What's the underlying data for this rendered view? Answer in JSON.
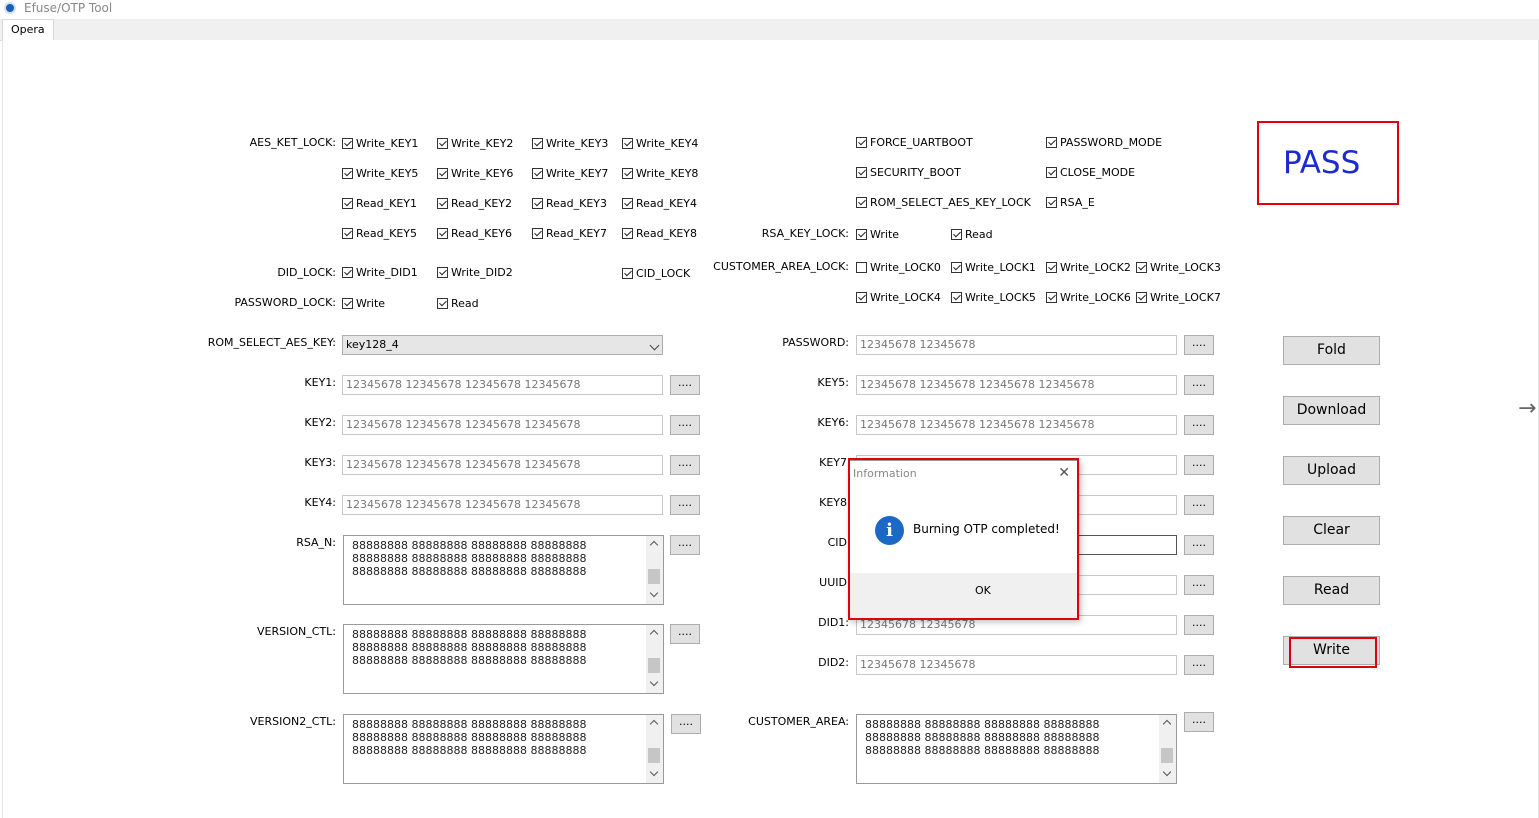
{
  "window": {
    "title": "Efuse/OTP Tool",
    "tab": "Opera"
  },
  "checks": {
    "aes_ket_lock_label": "AES_KET_LOCK:",
    "write_key1": "Write_KEY1",
    "write_key2": "Write_KEY2",
    "write_key3": "Write_KEY3",
    "write_key4": "Write_KEY4",
    "write_key5": "Write_KEY5",
    "write_key6": "Write_KEY6",
    "write_key7": "Write_KEY7",
    "write_key8": "Write_KEY8",
    "read_key1": "Read_KEY1",
    "read_key2": "Read_KEY2",
    "read_key3": "Read_KEY3",
    "read_key4": "Read_KEY4",
    "read_key5": "Read_KEY5",
    "read_key6": "Read_KEY6",
    "read_key7": "Read_KEY7",
    "read_key8": "Read_KEY8",
    "did_lock_label": "DID_LOCK:",
    "write_did1": "Write_DID1",
    "write_did2": "Write_DID2",
    "cid_lock": "CID_LOCK",
    "password_lock_label": "PASSWORD_LOCK:",
    "pw_write": "Write",
    "pw_read": "Read",
    "force_uartboot": "FORCE_UARTBOOT",
    "password_mode": "PASSWORD_MODE",
    "security_boot": "SECURITY_BOOT",
    "close_mode": "CLOSE_MODE",
    "rom_select_aes_key_lock": "ROM_SELECT_AES_KEY_LOCK",
    "rsa_e": "RSA_E",
    "rsa_key_lock_label": "RSA_KEY_LOCK:",
    "rsa_write": "Write",
    "rsa_read": "Read",
    "customer_area_lock_label": "CUSTOMER_AREA_LOCK:",
    "write_lock0": "Write_LOCK0",
    "write_lock1": "Write_LOCK1",
    "write_lock2": "Write_LOCK2",
    "write_lock3": "Write_LOCK3",
    "write_lock4": "Write_LOCK4",
    "write_lock5": "Write_LOCK5",
    "write_lock6": "Write_LOCK6",
    "write_lock7": "Write_LOCK7"
  },
  "fields": {
    "rom_select_label": "ROM_SELECT_AES_KEY:",
    "rom_select_value": "key128_4",
    "key1_label": "KEY1:",
    "key1": "12345678 12345678 12345678 12345678",
    "key2_label": "KEY2:",
    "key2": "12345678 12345678 12345678 12345678",
    "key3_label": "KEY3:",
    "key3": "12345678 12345678 12345678 12345678",
    "key4_label": "KEY4:",
    "key4": "12345678 12345678 12345678 12345678",
    "rsa_n_label": "RSA_N:",
    "rsa_n": "88888888 88888888 88888888 88888888\n88888888 88888888 88888888 88888888\n88888888 88888888 88888888 88888888",
    "version_ctl_label": "VERSION_CTL:",
    "version_ctl": "88888888 88888888 88888888 88888888\n88888888 88888888 88888888 88888888\n88888888 88888888 88888888 88888888",
    "version2_ctl_label": "VERSION2_CTL:",
    "version2_ctl": "88888888 88888888 88888888 88888888\n88888888 88888888 88888888 88888888\n88888888 88888888 88888888 88888888",
    "password_label": "PASSWORD:",
    "password": "12345678 12345678",
    "key5_label": "KEY5:",
    "key5": "12345678 12345678 12345678 12345678",
    "key6_label": "KEY6:",
    "key6": "12345678 12345678 12345678 12345678",
    "key7_label": "KEY7",
    "key8_label": "KEY8",
    "cid_label": "CID",
    "uuid_label": "UUID",
    "did1_label": "DID1:",
    "did1": "12345678 12345678",
    "did2_label": "DID2:",
    "did2": "12345678 12345678",
    "customer_area_label": "CUSTOMER_AREA:",
    "customer_area": "88888888 88888888 88888888 88888888\n88888888 88888888 88888888 88888888\n88888888 88888888 88888888 88888888",
    "dots": "...."
  },
  "status": {
    "result": "PASS"
  },
  "buttons": {
    "fold": "Fold",
    "download": "Download",
    "upload": "Upload",
    "clear": "Clear",
    "read": "Read",
    "write": "Write"
  },
  "dialog": {
    "title": "Information",
    "close": "✕",
    "icon": "i",
    "message": "Burning OTP completed!",
    "ok": "OK"
  },
  "colors": {
    "highlight": "#e0000f",
    "pass_text": "#1c2bd0",
    "info_icon": "#1b69c5"
  }
}
